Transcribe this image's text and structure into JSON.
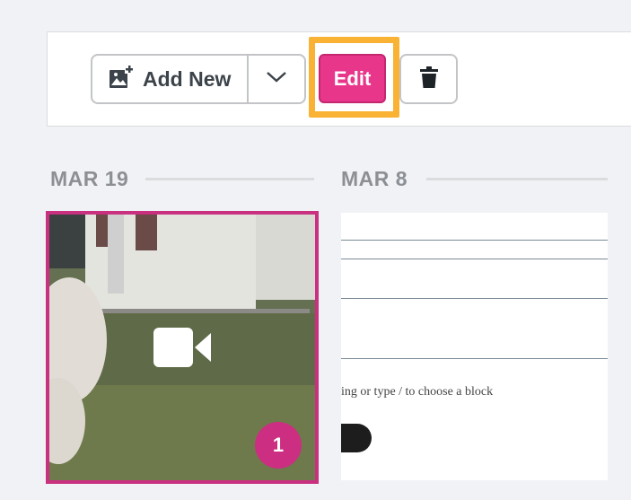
{
  "toolbar": {
    "add_new_label": "Add New",
    "edit_label": "Edit"
  },
  "columns": [
    {
      "date": "MAR 19",
      "item": {
        "type": "video",
        "count": "1"
      }
    },
    {
      "date": "MAR 8",
      "item": {
        "type": "document",
        "text": "ing or type / to choose a block"
      }
    }
  ],
  "colors": {
    "accent_pink": "#e8378b",
    "highlight": "#f9b233",
    "badge": "#cc2e82"
  }
}
